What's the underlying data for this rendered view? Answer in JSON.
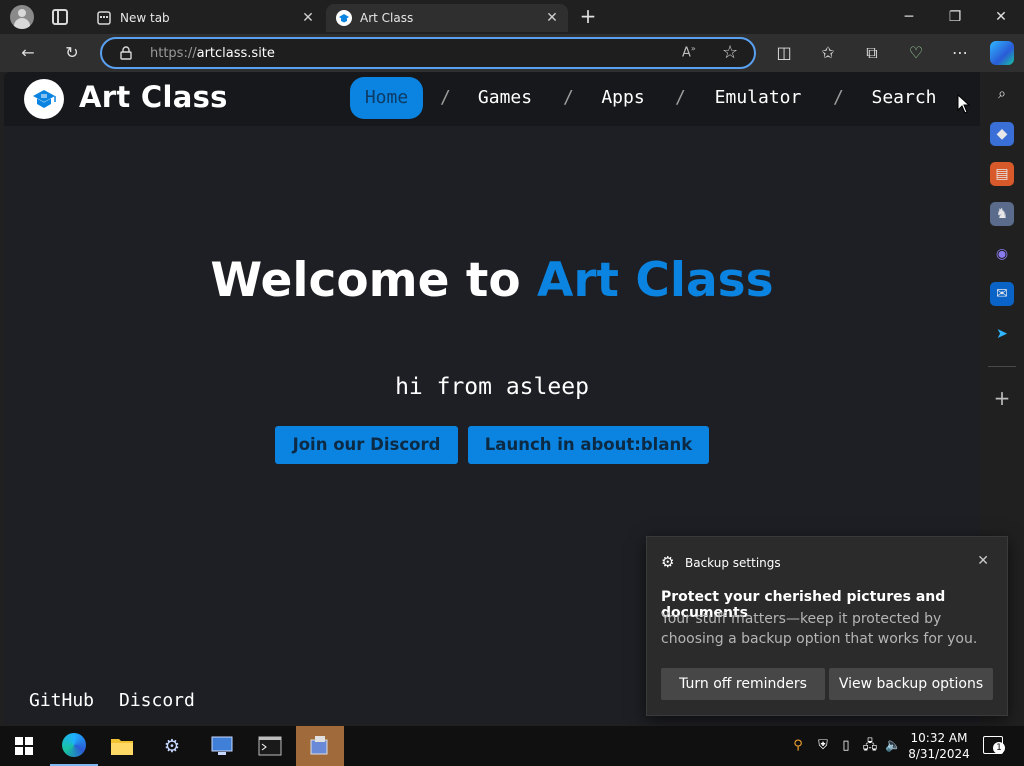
{
  "browser": {
    "tabs": [
      {
        "title": "New tab",
        "active": false
      },
      {
        "title": "Art Class",
        "active": true
      }
    ],
    "address": {
      "scheme": "https://",
      "host": "artclass.site"
    }
  },
  "site": {
    "title": "Art Class",
    "nav": [
      {
        "label": "Home",
        "active": true
      },
      {
        "label": "Games"
      },
      {
        "label": "Apps"
      },
      {
        "label": "Emulator"
      },
      {
        "label": "Search"
      }
    ],
    "nav_separator": "/",
    "hero": {
      "title_prefix": "Welcome to ",
      "title_accent": "Art Class",
      "subtitle": "hi from asleep",
      "buttons": [
        "Join our Discord",
        "Launch in about:blank"
      ]
    },
    "footer_links": [
      "GitHub",
      "Discord"
    ],
    "colors": {
      "accent": "#0a84e0",
      "background": "#1e1f24",
      "nav": "#17181b"
    }
  },
  "toast": {
    "app": "Backup settings",
    "title": "Protect your cherished pictures and documents",
    "body": "Your stuff matters—keep it protected by choosing a backup option that works for you.",
    "buttons": [
      "Turn off reminders",
      "View backup options"
    ]
  },
  "taskbar": {
    "time": "10:32 AM",
    "date": "8/31/2024",
    "notification_count": "1"
  }
}
